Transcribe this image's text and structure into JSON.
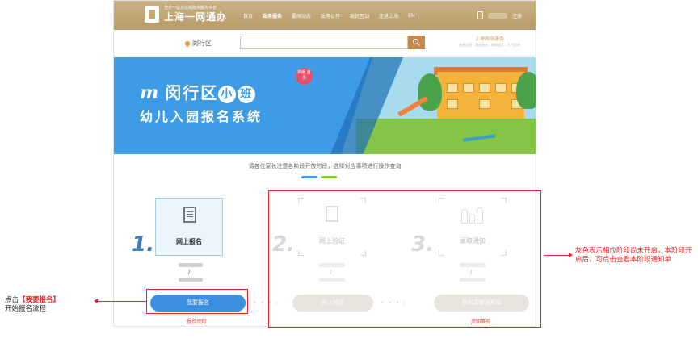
{
  "header": {
    "logo_sub": "全市一站式在线政务服务平台",
    "logo_title": "上海一网通办",
    "nav": [
      "首页",
      "政务服务",
      "要闻动态",
      "政务公开",
      "政民互动",
      "走进上海",
      "EN"
    ],
    "register": "注册"
  },
  "search": {
    "district": "闵行区",
    "placeholder": "",
    "hotline_title": "上海政府服务",
    "hotline_sub": "智能问答 · 政务服务 · 网络留言 · 人气咨询"
  },
  "banner": {
    "district": "闵行区",
    "xiao": "小",
    "ban": "班",
    "badge": "新版 首页",
    "subtitle": "幼儿入园报名系统"
  },
  "notice": "请各位家长注意各阶段开放时段，选择对应事项进行操作查询",
  "steps": [
    {
      "num": "1.",
      "label": "网上报名",
      "date_sep": "/",
      "button": "我要报名",
      "note": "报名须知"
    },
    {
      "num": "2.",
      "label": "网上验证",
      "date_sep": "/",
      "button": "网上验证"
    },
    {
      "num": "3.",
      "label": "录取通知",
      "date_sep": "/",
      "button": "我的录取通知单",
      "note": "须知事项"
    }
  ],
  "callouts": {
    "left_prefix": "点击",
    "left_highlight": "【我要报名】",
    "left_line2": "开始报名流程",
    "right": "灰色表示相应阶段尚未开启，本阶段开启后，可点击查看本阶段通知单"
  },
  "colors": {
    "header": "#c9b083",
    "banner_blue": "#3e9ce6",
    "primary_button": "#3d8fe0",
    "annotation_red": "#e22222",
    "step1_number": "#3b7fc4",
    "disabled": "#d8d8d8"
  }
}
